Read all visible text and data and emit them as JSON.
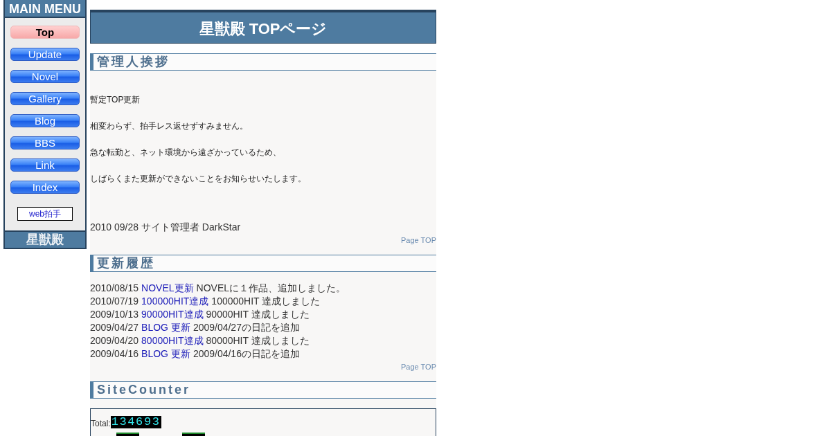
{
  "sidebar": {
    "title": "MAIN MENU",
    "items": [
      {
        "label": "Top",
        "selected": true
      },
      {
        "label": "Update",
        "selected": false
      },
      {
        "label": "Novel",
        "selected": false
      },
      {
        "label": "Gallery",
        "selected": false
      },
      {
        "label": "Blog",
        "selected": false
      },
      {
        "label": "BBS",
        "selected": false
      },
      {
        "label": "Link",
        "selected": false
      },
      {
        "label": "Index",
        "selected": false
      }
    ],
    "clap_link": "web拍手",
    "footer": "星獣殿"
  },
  "page_title": "星獣殿 TOPページ",
  "sections": [
    {
      "kind": "text",
      "heading": "管理人挨拶",
      "paragraphs": [
        "暫定TOP更新",
        "相変わらず、拍手レス返せずすみません。",
        "急な転勤と、ネット環境から遠ざかっているため、",
        "しばらくまた更新ができないことをお知らせいたします。"
      ],
      "signature": "2010 09/28 サイト管理者 DarkStar",
      "page_top": "Page TOP"
    },
    {
      "kind": "updates",
      "heading": "更新履歴",
      "entries": [
        {
          "date": "2010/08/15",
          "link": "NOVEL更新",
          "text": "NOVELに１作品、追加しました。"
        },
        {
          "date": "2010/07/19",
          "link": "100000HIT達成",
          "text": "100000HIT 達成しました"
        },
        {
          "date": "2009/10/13",
          "link": "90000HIT達成",
          "text": "90000HIT 達成しました"
        },
        {
          "date": "2009/04/27",
          "link": "BLOG 更新",
          "text": "2009/04/27の日記を追加"
        },
        {
          "date": "2009/04/20",
          "link": "80000HIT達成",
          "text": "80000HIT 達成しました"
        },
        {
          "date": "2009/04/16",
          "link": "BLOG 更新",
          "text": "2009/04/16の日記を追加"
        }
      ],
      "page_top": "Page TOP"
    },
    {
      "kind": "counter",
      "heading": "SiteCounter",
      "total_label": "Total:",
      "total": "134693",
      "partial_counters": [
        {
          "kind": "digit-image"
        },
        {
          "kind": "digit-image"
        }
      ]
    }
  ]
}
